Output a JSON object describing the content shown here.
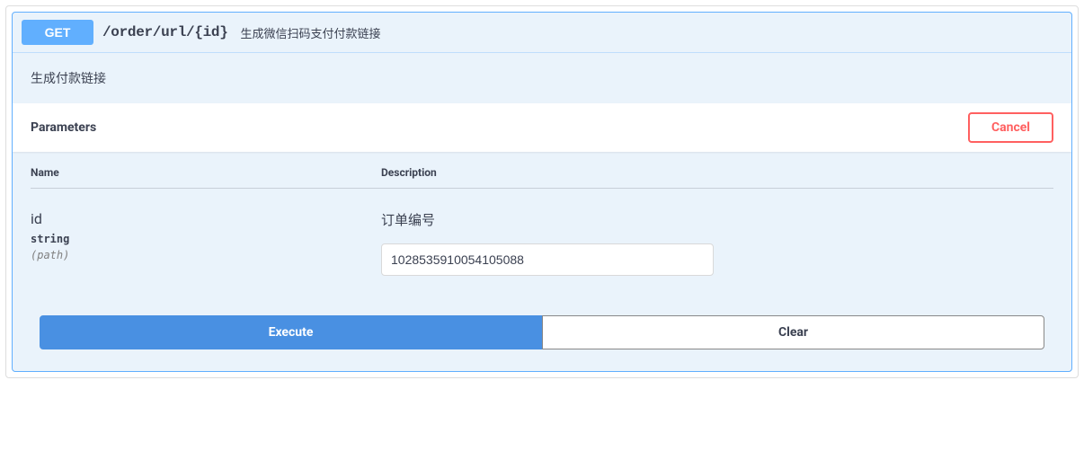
{
  "method": "GET",
  "path": "/order/url/{id}",
  "summary": "生成微信扫码支付付款链接",
  "description": "生成付款链接",
  "parameters_section": {
    "title": "Parameters",
    "cancel_label": "Cancel",
    "columns": {
      "name": "Name",
      "description": "Description"
    },
    "items": [
      {
        "name": "id",
        "type": "string",
        "in": "(path)",
        "description": "订单编号",
        "value": "1028535910054105088"
      }
    ]
  },
  "actions": {
    "execute_label": "Execute",
    "clear_label": "Clear"
  }
}
